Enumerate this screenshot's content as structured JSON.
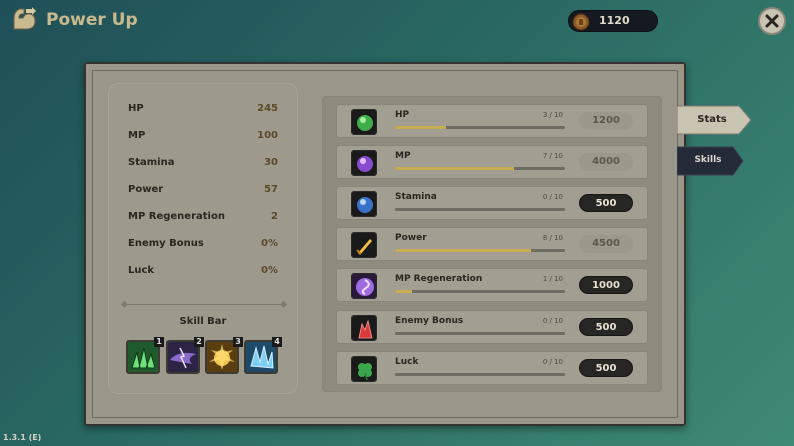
{
  "header": {
    "title": "Power Up",
    "title_icon": "flexed-arm-icon",
    "currency": {
      "icon": "coin-icon",
      "value": "1120"
    },
    "close_icon": "close-icon"
  },
  "stats": [
    {
      "label": "HP",
      "value": "245"
    },
    {
      "label": "MP",
      "value": "100"
    },
    {
      "label": "Stamina",
      "value": "30"
    },
    {
      "label": "Power",
      "value": "57"
    },
    {
      "label": "MP Regeneration",
      "value": "2"
    },
    {
      "label": "Enemy Bonus",
      "value": "0%"
    },
    {
      "label": "Luck",
      "value": "0%"
    }
  ],
  "skill_bar": {
    "title": "Skill Bar",
    "slots": [
      {
        "number": "1",
        "icon": "green-spikes-skill-icon"
      },
      {
        "number": "2",
        "icon": "purple-storm-skill-icon"
      },
      {
        "number": "3",
        "icon": "golden-burst-skill-icon"
      },
      {
        "number": "4",
        "icon": "ice-crystal-skill-icon"
      }
    ]
  },
  "upgrades": [
    {
      "label": "HP",
      "level": "3 / 10",
      "progress": 0.3,
      "cost": "1200",
      "affordable": false,
      "icon": "green-orb-icon"
    },
    {
      "label": "MP",
      "level": "7 / 10",
      "progress": 0.7,
      "cost": "4000",
      "affordable": false,
      "icon": "purple-orb-icon"
    },
    {
      "label": "Stamina",
      "level": "0 / 10",
      "progress": 0.0,
      "cost": "500",
      "affordable": true,
      "icon": "blue-orb-icon"
    },
    {
      "label": "Power",
      "level": "8 / 10",
      "progress": 0.8,
      "cost": "4500",
      "affordable": false,
      "icon": "gold-sword-icon"
    },
    {
      "label": "MP Regeneration",
      "level": "1 / 10",
      "progress": 0.1,
      "cost": "1000",
      "affordable": true,
      "icon": "violet-swirl-icon"
    },
    {
      "label": "Enemy Bonus",
      "level": "0 / 10",
      "progress": 0.0,
      "cost": "500",
      "affordable": true,
      "icon": "red-crystal-icon"
    },
    {
      "label": "Luck",
      "level": "0 / 10",
      "progress": 0.0,
      "cost": "500",
      "affordable": true,
      "icon": "four-leaf-clover-icon"
    }
  ],
  "tabs": [
    {
      "label": "Stats",
      "active": true
    },
    {
      "label": "Skills",
      "active": false
    }
  ],
  "version": "1.3.1 (E)",
  "colors": {
    "background": "#2a6a63",
    "panel": "#9a9689",
    "progress_fill": "#c9ad52",
    "enabled_button": "#262625"
  }
}
